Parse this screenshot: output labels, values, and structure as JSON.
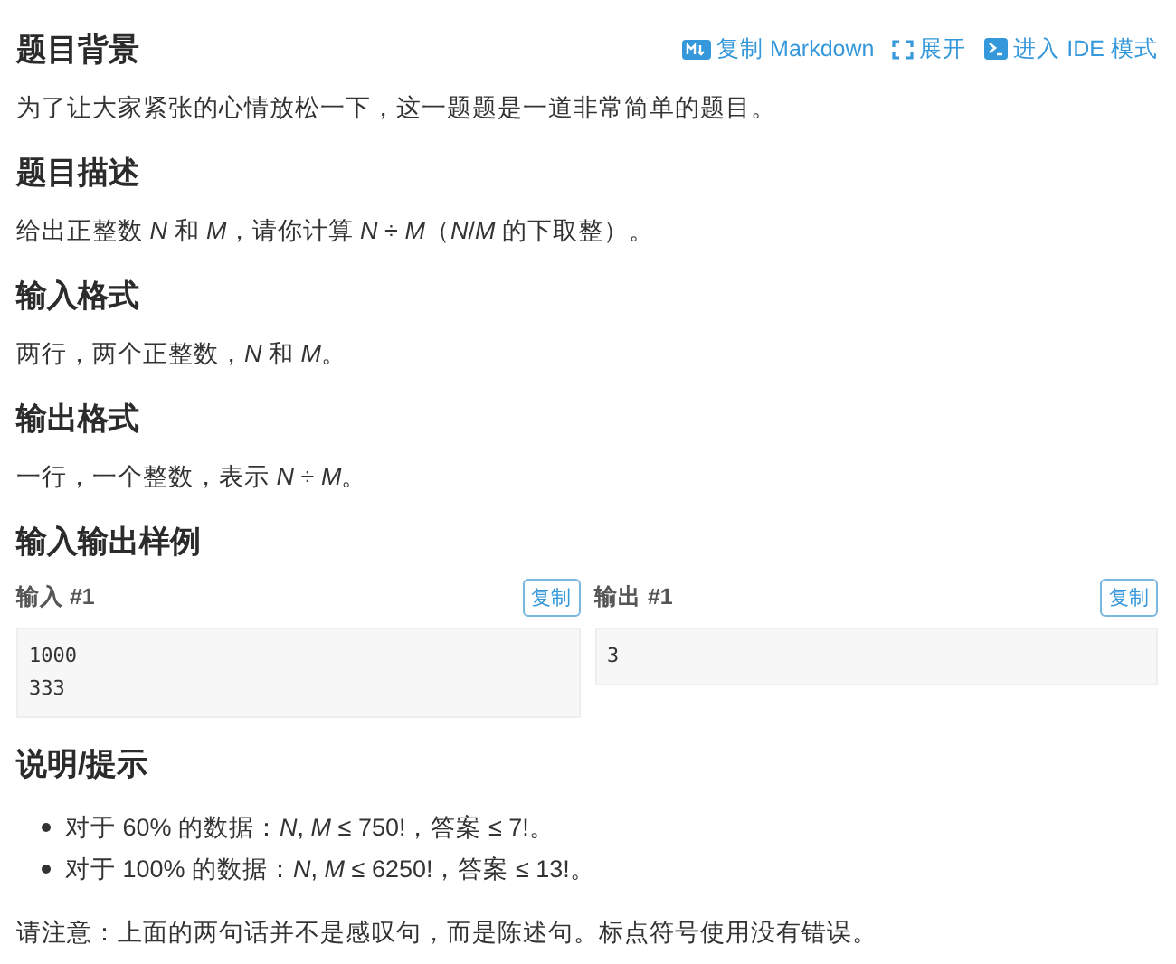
{
  "toolbar": [
    {
      "kind": "markdown",
      "label": "复制 Markdown"
    },
    {
      "kind": "expand",
      "label": "展开"
    },
    {
      "kind": "terminal",
      "label": "进入 IDE 模式"
    }
  ],
  "sections": [
    {
      "kind": "text",
      "title": "题目背景",
      "text": "为了让大家紧张的心情放松一下，这一题题是一道非常简单的题目。"
    },
    {
      "kind": "text",
      "title": "题目描述",
      "text": "给出正整数 *N* 和 *M*，请你计算 *N* ÷ *M*（*N*/*M* 的下取整）。"
    },
    {
      "kind": "text",
      "title": "输入格式",
      "text": "两行，两个正整数，*N* 和 *M*。"
    },
    {
      "kind": "text",
      "title": "输出格式",
      "text": "一行，一个整数，表示 *N* ÷ *M*。"
    },
    {
      "kind": "samples",
      "title": "输入输出样例",
      "samples": [
        {
          "label": "输入 #1",
          "button": "复制",
          "lines": [
            "1000",
            "333"
          ]
        },
        {
          "label": "输出 #1",
          "button": "复制",
          "lines": [
            "3"
          ]
        }
      ]
    },
    {
      "kind": "list",
      "title": "说明/提示",
      "items": [
        "对于 60% 的数据：*N*, *M* ≤ 750!，答案 ≤ 7!。",
        "对于 100% 的数据：*N*, *M* ≤ 6250!，答案 ≤ 13!。"
      ],
      "text": "请注意：上面的两句话并不是感叹句，而是陈述句。标点符号使用没有错误。"
    }
  ]
}
